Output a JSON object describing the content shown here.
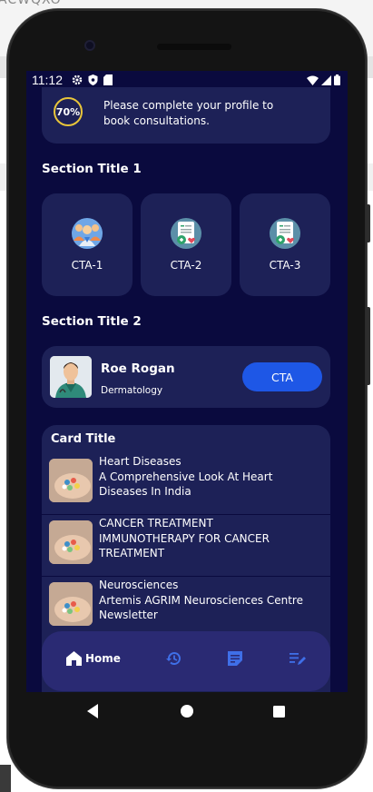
{
  "background": {
    "window_text": "ACWQXO"
  },
  "status_bar": {
    "time": "11:12"
  },
  "profile_prompt": {
    "percent": "70%",
    "progress_fraction": 0.7,
    "text": "Please complete your profile to book consultations."
  },
  "section1": {
    "title": "Section Title 1",
    "tiles": [
      {
        "label": "CTA-1",
        "icon": "doctor-group-icon"
      },
      {
        "label": "CTA-2",
        "icon": "medical-report-icon"
      },
      {
        "label": "CTA-3",
        "icon": "medical-report-icon"
      }
    ]
  },
  "section2": {
    "title": "Section Title 2",
    "doctor": {
      "name": "Roe Rogan",
      "specialty": "Dermatology",
      "cta": "CTA"
    }
  },
  "card": {
    "title": "Card Title",
    "items": [
      {
        "text": "Heart Diseases\nA Comprehensive Look At Heart\nDiseases In India"
      },
      {
        "text": " CANCER TREATMENT\nIMMUNOTHERAPY FOR CANCER\nTREATMENT"
      },
      {
        "text": "Neurosciences\nArtemis AGRIM Neurosciences Centre\nNewsletter"
      }
    ]
  },
  "bottom_nav": {
    "items": [
      {
        "label": "Home",
        "icon": "home-icon",
        "active": true
      },
      {
        "label": "",
        "icon": "history-icon"
      },
      {
        "label": "",
        "icon": "notes-icon"
      },
      {
        "label": "",
        "icon": "edit-list-icon"
      }
    ]
  },
  "colors": {
    "screen_bg": "#0a0a3e",
    "card_bg": "#1d2157",
    "navbar_bg": "#2a2a73",
    "accent_blue": "#1e57e6",
    "ring_yellow": "#e8c53a"
  }
}
